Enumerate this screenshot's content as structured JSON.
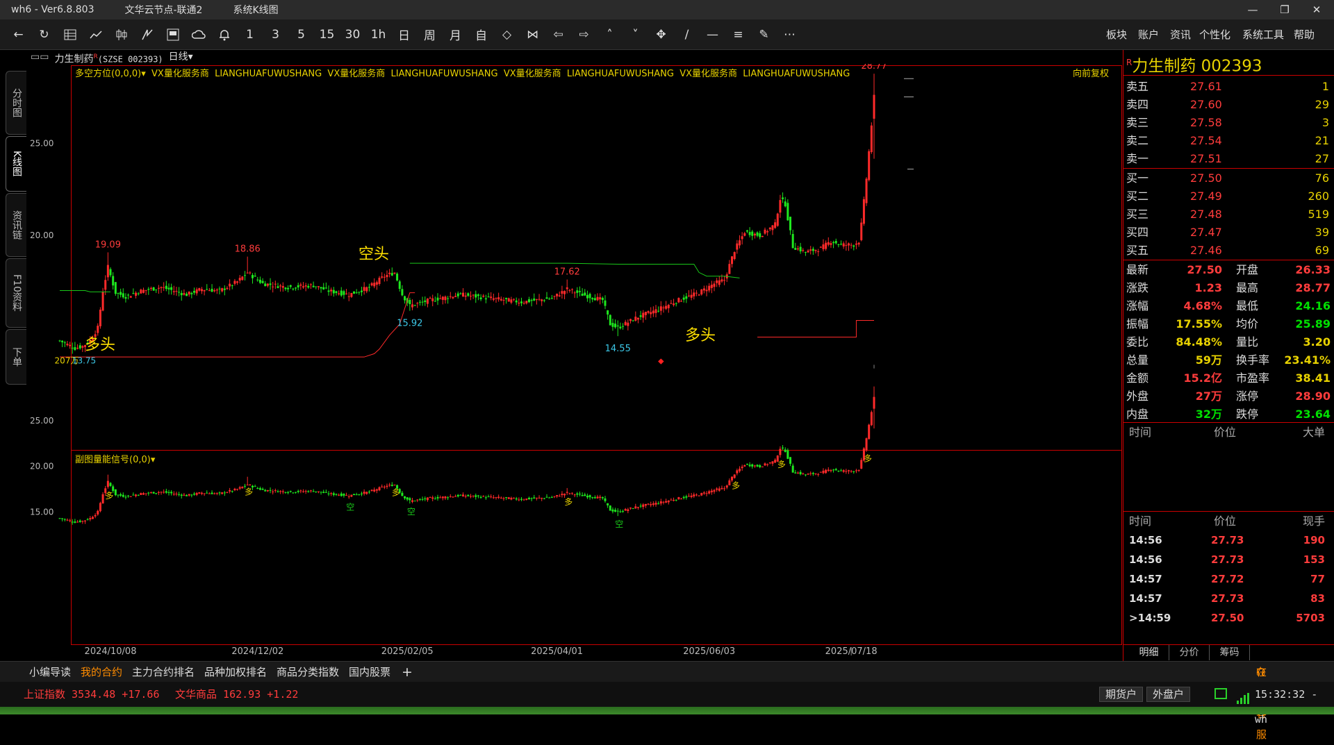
{
  "app": {
    "name": "wh6",
    "sep": "-",
    "version": "Ver6.8.803",
    "node": "文华云节点-联通2",
    "view": "系统K线图"
  },
  "window_controls": [
    "—",
    "❐",
    "✕"
  ],
  "toolbar": {
    "icons": [
      "back-icon",
      "refresh-icon",
      "table-icon",
      "line-chart-icon",
      "kline-icon",
      "flash-chart-icon",
      "screen-icon",
      "cloud-sync-icon",
      "bell-icon"
    ],
    "periods": [
      "1",
      "3",
      "5",
      "15",
      "30",
      "1h",
      "日",
      "周",
      "月",
      "自"
    ],
    "tool_icons": [
      "diamond-icon",
      "bowtie-icon",
      "left-arrow-icon",
      "right-arrow-icon",
      "up-chevron-icon",
      "down-chevron-icon",
      "crosshair-icon",
      "trend-line-icon",
      "hline-icon",
      "fib-icon",
      "erase-icon",
      "more-icon"
    ],
    "menus": [
      "板块",
      "账户",
      "资讯",
      "个性化",
      "系统工具",
      "帮助"
    ]
  },
  "left_tabs": [
    "分时图",
    "K线图",
    "资讯链",
    "F10资料",
    "下单"
  ],
  "stock_header": {
    "icon": "▭▭",
    "name": "力生制药",
    "badge": "R",
    "code": "(SZSE 002393)",
    "period": "日线",
    "period_arrow": "▾"
  },
  "main_indicator": {
    "name": "多空方位(0,0,0)",
    "arrow": "▾",
    "texts": [
      "VX量化服务商",
      "LIANGHUAFUWUSHANG",
      "VX量化服务商",
      "LIANGHUAFUWUSHANG",
      "VX量化服务商",
      "LIANGHUAFUWUSHANG",
      "VX量化服务商",
      "LIANGHUAFUWUSHANG"
    ],
    "adjust": "向前复权"
  },
  "sub_indicator": {
    "name": "副图量能信号(0,0)",
    "arrow": "▾"
  },
  "chart_labels": {
    "kong": "空头",
    "duo_left": "多头",
    "duo_right": "多头",
    "low_left": "13.75",
    "low_left_prefix": "207万",
    "signal_duo": "多",
    "signal_kong": "空"
  },
  "chart_data": [
    {
      "type": "candlestick",
      "title": "",
      "y_ticks": [
        "25.00",
        "20.00"
      ],
      "ylim": [
        12.9,
        29.3
      ],
      "x_ticks": [
        "2024/10/08",
        "2024/12/02",
        "2025/02/05",
        "2025/04/01",
        "2025/06/03",
        "2025/07/18"
      ],
      "annotations": [
        {
          "label": "19.09",
          "value": 19.09,
          "date": "2024/10/08"
        },
        {
          "label": "18.86",
          "value": 18.86,
          "date": "2024/11"
        },
        {
          "label": "15.92",
          "value": 15.92,
          "date": "2025/01"
        },
        {
          "label": "17.62",
          "value": 17.62,
          "date": "2025/03"
        },
        {
          "label": "14.55",
          "value": 14.55,
          "date": "2025/04"
        },
        {
          "label": "28.77",
          "value": 28.77,
          "date": "2025/07/18"
        }
      ],
      "close_anchors": [
        {
          "i": 0,
          "v": 14.3
        },
        {
          "i": 3,
          "v": 14.1
        },
        {
          "i": 6,
          "v": 13.9
        },
        {
          "i": 9,
          "v": 14.0
        },
        {
          "i": 12,
          "v": 14.3
        },
        {
          "i": 15,
          "v": 15.0
        },
        {
          "i": 17,
          "v": 17.0
        },
        {
          "i": 19,
          "v": 18.3
        },
        {
          "i": 22,
          "v": 16.9
        },
        {
          "i": 26,
          "v": 16.7
        },
        {
          "i": 32,
          "v": 17.0
        },
        {
          "i": 40,
          "v": 17.2
        },
        {
          "i": 50,
          "v": 16.8
        },
        {
          "i": 56,
          "v": 17.1
        },
        {
          "i": 63,
          "v": 17.0
        },
        {
          "i": 70,
          "v": 17.5
        },
        {
          "i": 74,
          "v": 18.0
        },
        {
          "i": 80,
          "v": 17.4
        },
        {
          "i": 90,
          "v": 17.2
        },
        {
          "i": 100,
          "v": 17.3
        },
        {
          "i": 106,
          "v": 17.0
        },
        {
          "i": 114,
          "v": 16.8
        },
        {
          "i": 122,
          "v": 17.2
        },
        {
          "i": 128,
          "v": 17.8
        },
        {
          "i": 132,
          "v": 18.0
        },
        {
          "i": 135,
          "v": 16.8
        },
        {
          "i": 138,
          "v": 16.2
        },
        {
          "i": 146,
          "v": 16.5
        },
        {
          "i": 158,
          "v": 16.8
        },
        {
          "i": 170,
          "v": 16.6
        },
        {
          "i": 182,
          "v": 16.4
        },
        {
          "i": 194,
          "v": 16.6
        },
        {
          "i": 200,
          "v": 17.1
        },
        {
          "i": 206,
          "v": 16.8
        },
        {
          "i": 214,
          "v": 16.5
        },
        {
          "i": 217,
          "v": 15.2
        },
        {
          "i": 220,
          "v": 15.0
        },
        {
          "i": 228,
          "v": 15.6
        },
        {
          "i": 236,
          "v": 16.0
        },
        {
          "i": 244,
          "v": 16.5
        },
        {
          "i": 252,
          "v": 16.9
        },
        {
          "i": 258,
          "v": 17.4
        },
        {
          "i": 262,
          "v": 17.6
        },
        {
          "i": 266,
          "v": 19.2
        },
        {
          "i": 270,
          "v": 20.2
        },
        {
          "i": 276,
          "v": 20.0
        },
        {
          "i": 282,
          "v": 20.6
        },
        {
          "i": 284,
          "v": 22.0
        },
        {
          "i": 286,
          "v": 21.7
        },
        {
          "i": 289,
          "v": 19.4
        },
        {
          "i": 294,
          "v": 19.1
        },
        {
          "i": 300,
          "v": 19.3
        },
        {
          "i": 304,
          "v": 19.7
        },
        {
          "i": 308,
          "v": 19.5
        },
        {
          "i": 313,
          "v": 19.5
        },
        {
          "i": 315,
          "v": 19.7
        },
        {
          "i": 316,
          "v": 20.6
        },
        {
          "i": 318,
          "v": 23.1
        },
        {
          "i": 320,
          "v": 26.0
        },
        {
          "i": 321,
          "v": 27.5
        }
      ]
    },
    {
      "type": "candlestick",
      "title": "",
      "y_ticks": [
        "25.00",
        "20.00",
        "15.00"
      ],
      "ylim": [
        13.5,
        29.5
      ],
      "x_ticks": [
        "2024/10/08",
        "2024/12/02",
        "2025/02/05",
        "2025/04/01",
        "2025/06/03",
        "2025/07/18"
      ]
    }
  ],
  "quote": {
    "title_badge": "R",
    "title": "力生制药  002393",
    "asks": [
      {
        "label": "卖五",
        "price": "27.61",
        "vol": "1"
      },
      {
        "label": "卖四",
        "price": "27.60",
        "vol": "29"
      },
      {
        "label": "卖三",
        "price": "27.58",
        "vol": "3"
      },
      {
        "label": "卖二",
        "price": "27.54",
        "vol": "21"
      },
      {
        "label": "卖一",
        "price": "27.51",
        "vol": "27"
      }
    ],
    "bids": [
      {
        "label": "买一",
        "price": "27.50",
        "vol": "76"
      },
      {
        "label": "买二",
        "price": "27.49",
        "vol": "260"
      },
      {
        "label": "买三",
        "price": "27.48",
        "vol": "519"
      },
      {
        "label": "买四",
        "price": "27.47",
        "vol": "39"
      },
      {
        "label": "买五",
        "price": "27.46",
        "vol": "69"
      }
    ],
    "stats": [
      {
        "l": "最新",
        "lv": "27.50",
        "lc": "#ff3c3c",
        "r": "开盘",
        "rv": "26.33",
        "rc": "#ff3c3c"
      },
      {
        "l": "涨跌",
        "lv": "1.23",
        "lc": "#ff3c3c",
        "r": "最高",
        "rv": "28.77",
        "rc": "#ff3c3c"
      },
      {
        "l": "涨幅",
        "lv": "4.68%",
        "lc": "#ff3c3c",
        "r": "最低",
        "rv": "24.16",
        "rc": "#00e000"
      },
      {
        "l": "振幅",
        "lv": "17.55%",
        "lc": "#e8d200",
        "r": "均价",
        "rv": "25.89",
        "rc": "#00e000"
      },
      {
        "l": "委比",
        "lv": "84.48%",
        "lc": "#e8d200",
        "r": "量比",
        "rv": "3.20",
        "rc": "#e8d200"
      },
      {
        "l": "总量",
        "lv": "59万",
        "lc": "#e8d200",
        "r": "换手率",
        "rv": "23.41%",
        "rc": "#e8d200"
      },
      {
        "l": "金额",
        "lv": "15.2亿",
        "lc": "#ff3c3c",
        "r": "市盈率",
        "rv": "38.41",
        "rc": "#e8d200"
      },
      {
        "l": "外盘",
        "lv": "27万",
        "lc": "#ff3c3c",
        "r": "涨停",
        "rv": "28.90",
        "rc": "#ff3c3c"
      },
      {
        "l": "内盘",
        "lv": "32万",
        "lc": "#00e000",
        "r": "跌停",
        "rv": "23.64",
        "rc": "#00e000"
      }
    ],
    "big_header": {
      "a": "时间",
      "b": "价位",
      "c": "大单"
    },
    "tick_header": {
      "a": "时间",
      "b": "价位",
      "c": "现手"
    },
    "ticks": [
      {
        "t": "14:56",
        "p": "27.73",
        "v": "190"
      },
      {
        "t": "14:56",
        "p": "27.73",
        "v": "153"
      },
      {
        "t": "14:57",
        "p": "27.72",
        "v": "77"
      },
      {
        "t": "14:57",
        "p": "27.73",
        "v": "83"
      },
      {
        "t": ">14:59",
        "p": "27.50",
        "v": "5703"
      }
    ],
    "bottom_tabs": [
      "明细",
      "分价",
      "筹码"
    ]
  },
  "bottom_tabs": [
    "小编导读",
    "我的合约",
    "主力合约排名",
    "品种加权排名",
    "商品分类指数",
    "国内股票",
    "+"
  ],
  "service": "在线客服",
  "status": {
    "idx1_name": "上证指数",
    "idx1_val": "3534.48",
    "idx1_chg": "+17.66",
    "idx2_name": "文华商品",
    "idx2_val": "162.93",
    "idx2_chg": "+1.22",
    "btn1": "期货户",
    "btn2": "外盘户",
    "time": "15:32:32 - wh"
  },
  "colors": {
    "up": "#ff2a2a",
    "down": "#1ee81e",
    "accent": "#e8d200",
    "border": "#c00000"
  }
}
